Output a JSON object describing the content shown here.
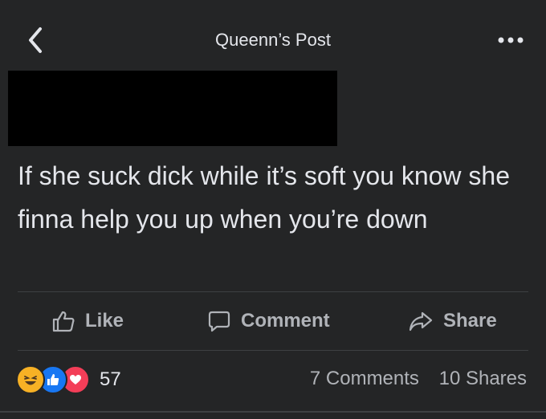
{
  "header": {
    "title": "Queenn’s Post",
    "back_icon": "chevron-left-icon",
    "more_icon": "more-dots-icon"
  },
  "post": {
    "text": "If she suck dick while it’s soft you know she finna help you up when you’re down"
  },
  "actions": {
    "like_label": "Like",
    "comment_label": "Comment",
    "share_label": "Share"
  },
  "footer": {
    "reaction_icons": [
      "haha-reaction-icon",
      "like-reaction-icon",
      "love-reaction-icon"
    ],
    "reaction_count": "57",
    "comments_text": "7 Comments",
    "shares_text": "10 Shares"
  },
  "colors": {
    "background": "#242526",
    "text": "#e4e6eb",
    "muted": "#b0b3b8",
    "divider": "#3e4042",
    "like_blue": "#1877f2",
    "love_red": "#f33e58",
    "haha_yellow": "#f7b125"
  }
}
